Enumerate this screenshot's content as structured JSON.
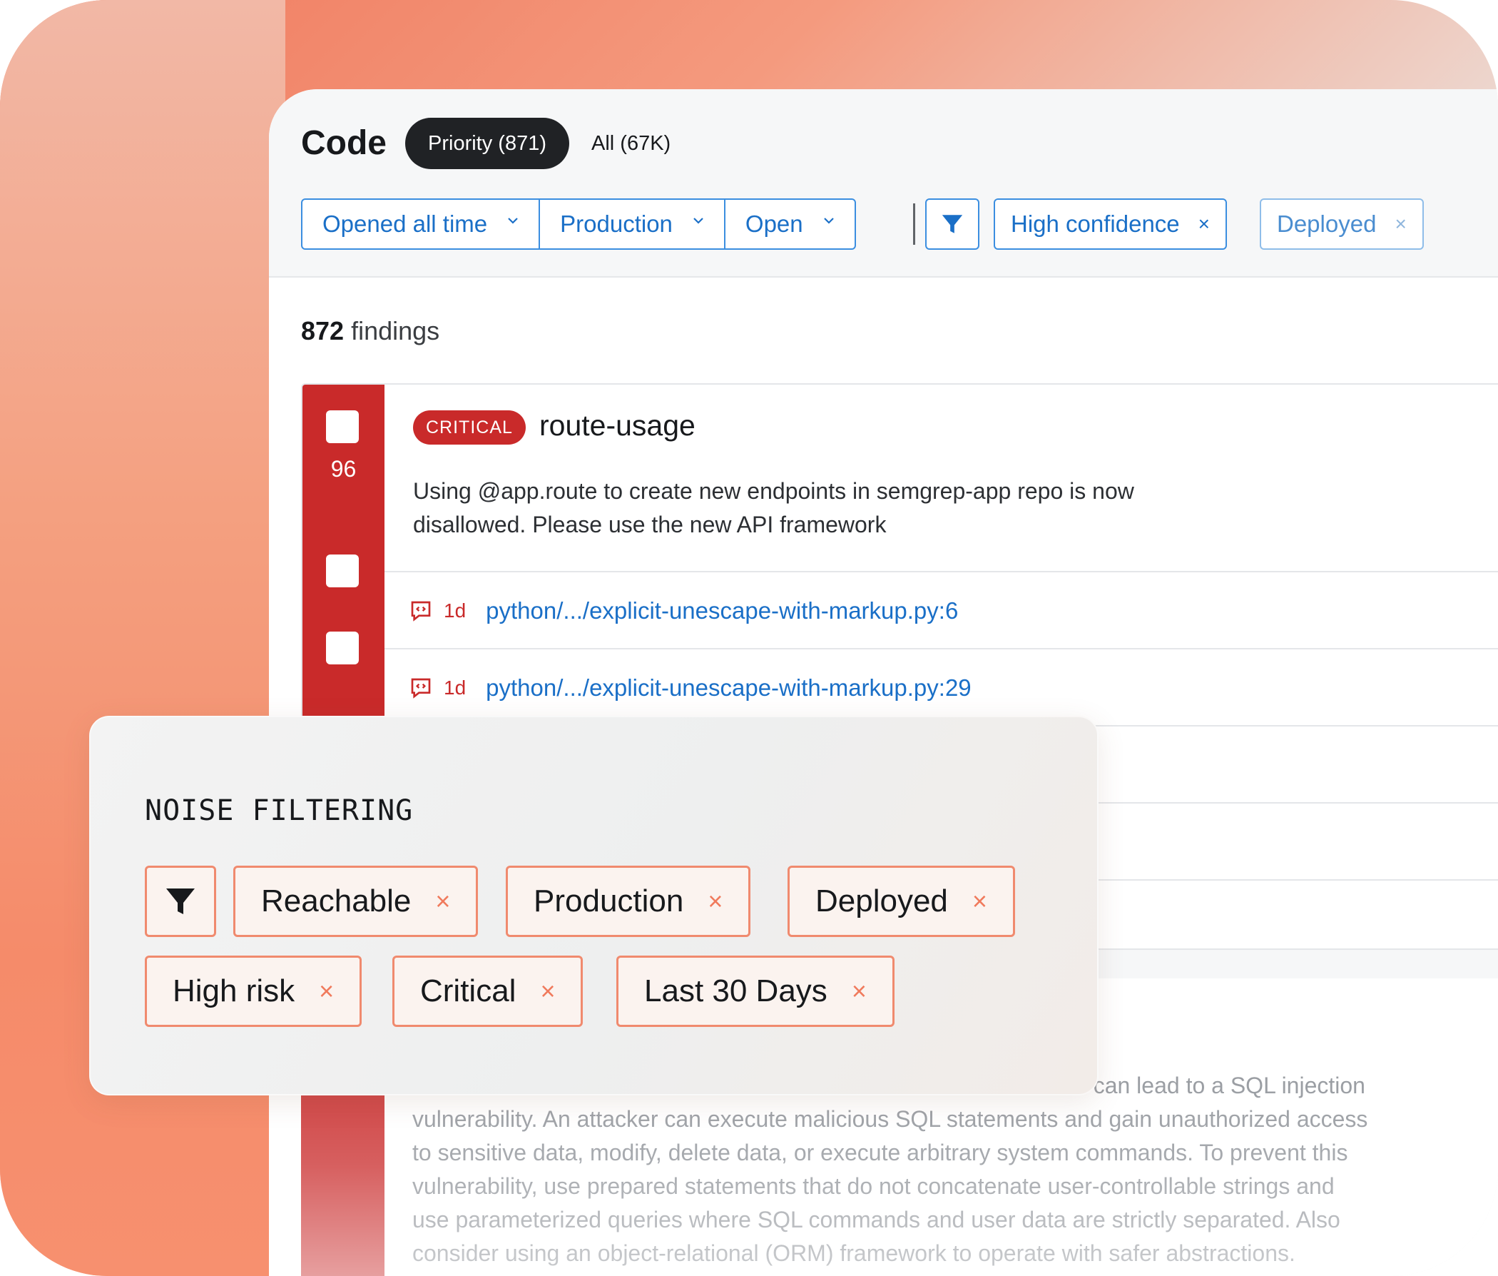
{
  "header": {
    "title": "Code",
    "tabs": [
      {
        "label": "Priority (871)",
        "active": true
      },
      {
        "label": "All (67K)",
        "active": false
      }
    ]
  },
  "filters": {
    "segmented": [
      {
        "label": "Opened all time"
      },
      {
        "label": "Production"
      },
      {
        "label": "Open"
      }
    ],
    "chips": [
      {
        "label": "High confidence",
        "remove": "×"
      },
      {
        "label": "Deployed",
        "remove": "×"
      }
    ]
  },
  "findings": {
    "count": "872",
    "count_label": "findings"
  },
  "finding": {
    "severity": "CRITICAL",
    "score": "96",
    "rule": "route-usage",
    "description": "Using @app.route to create new endpoints in semgrep-app repo is now disallowed. Please use the new API framework",
    "locations": [
      {
        "age": "1d",
        "path": "python/.../explicit-unescape-with-markup.py:6"
      },
      {
        "age": "1d",
        "path": "python/.../explicit-unescape-with-markup.py:29"
      }
    ]
  },
  "lower_finding": {
    "description_lines": [
      "ch can lead to a SQL injection",
      "vulnerability. An attacker can execute malicious SQL statements and gain unauthorized access",
      "to sensitive data, modify, delete data, or execute arbitrary system commands. To prevent this",
      "vulnerability, use prepared statements that do not concatenate user-controllable strings and",
      "use parameterized queries where SQL commands and user data are strictly separated. Also",
      "consider using an object-relational (ORM) framework to operate with safer abstractions."
    ]
  },
  "noise_filtering": {
    "title": "NOISE FILTERING",
    "chips": [
      {
        "label": "Reachable",
        "remove": "×"
      },
      {
        "label": "Production",
        "remove": "×"
      },
      {
        "label": "Deployed",
        "remove": "×"
      },
      {
        "label": "High risk",
        "remove": "×"
      },
      {
        "label": "Critical",
        "remove": "×"
      },
      {
        "label": "Last 30 Days",
        "remove": "×"
      }
    ]
  },
  "colors": {
    "accent_blue": "#1a6fc7",
    "critical_red": "#c92a2a",
    "noise_orange": "#f08a6e"
  },
  "icons": [
    "chevron-down-icon",
    "filter-icon",
    "close-icon",
    "code-comment-icon"
  ]
}
